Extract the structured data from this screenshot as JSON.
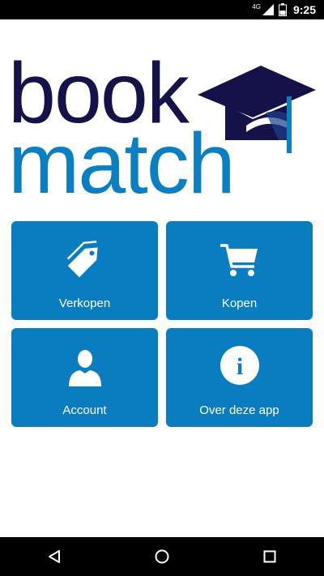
{
  "status_bar": {
    "network": "4G",
    "time": "9:25"
  },
  "logo": {
    "line1": "book",
    "line2": "match"
  },
  "colors": {
    "brand_dark": "#15124a",
    "brand_blue": "#0a80c3",
    "tile_blue": "#0a7dc1"
  },
  "menu": {
    "tiles": [
      {
        "label": "Verkopen",
        "icon": "price-tag-icon"
      },
      {
        "label": "Kopen",
        "icon": "shopping-cart-icon"
      },
      {
        "label": "Account",
        "icon": "user-icon"
      },
      {
        "label": "Over deze app",
        "icon": "info-icon"
      }
    ]
  },
  "nav_bar": {
    "buttons": [
      "back-icon",
      "home-icon",
      "recents-icon"
    ]
  }
}
